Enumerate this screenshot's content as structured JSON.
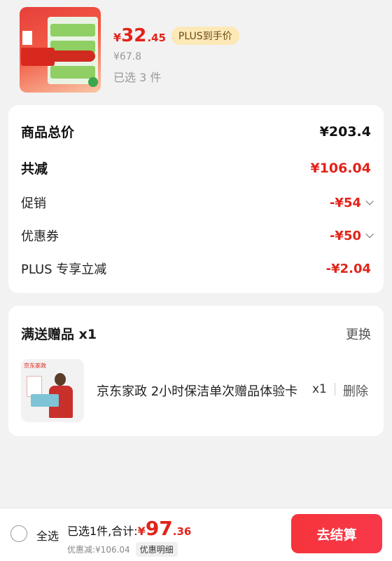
{
  "product": {
    "price_symbol": "¥",
    "price_int": "32",
    "price_dec": ".45",
    "plus_badge": "PLUS到手价",
    "original_price": "¥67.8",
    "selected": "已选 3 件"
  },
  "summary": {
    "rows": [
      {
        "label": "商品总价",
        "value": "¥203.4"
      },
      {
        "label": "共减",
        "value": "¥106.04"
      },
      {
        "label": "促销",
        "value": "-¥54"
      },
      {
        "label": "优惠券",
        "value": "-¥50"
      },
      {
        "label": "PLUS 专享立减",
        "value": "-¥2.04"
      }
    ]
  },
  "gift": {
    "title": "满送赠品 x1",
    "change_label": "更换",
    "thumb_brand": "京东家政",
    "name": "京东家政 2小时保洁单次赠品体验卡",
    "qty": "x1",
    "delete_label": "删除"
  },
  "bottom": {
    "select_all": "全选",
    "total_label": "已选1件,合计:",
    "total_symbol": "¥",
    "total_int": "97",
    "total_dec": ".36",
    "discount": "优惠减:¥106.04",
    "detail_label": "优惠明细",
    "checkout_label": "去结算"
  },
  "colors": {
    "accent_red": "#e2231a",
    "plus_gold": "#fde9b8"
  }
}
